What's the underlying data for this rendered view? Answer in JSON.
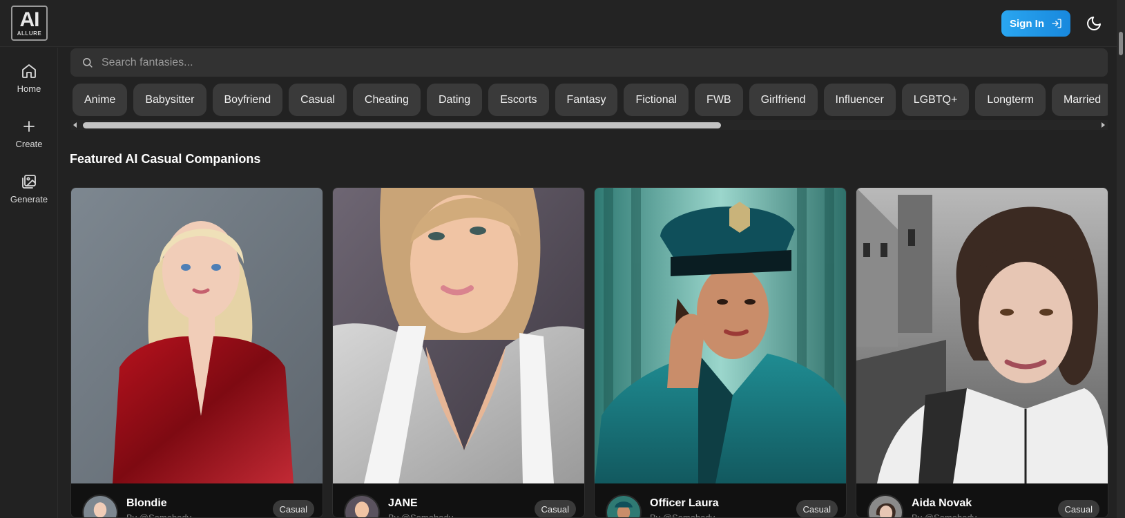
{
  "header": {
    "logo_mark": "AI",
    "logo_word": "ALLURE",
    "sign_in_label": "Sign In",
    "sign_in_icon": "login-arrow-icon",
    "theme_icon": "moon-icon"
  },
  "sidebar": {
    "items": [
      {
        "label": "Home",
        "icon": "home-icon"
      },
      {
        "label": "Create",
        "icon": "plus-icon"
      },
      {
        "label": "Generate",
        "icon": "image-gallery-icon"
      }
    ]
  },
  "search": {
    "placeholder": "Search fantasies...",
    "value": "",
    "icon": "search-icon"
  },
  "categories": [
    "Anime",
    "Babysitter",
    "Boyfriend",
    "Casual",
    "Cheating",
    "Dating",
    "Escorts",
    "Fantasy",
    "Fictional",
    "FWB",
    "Girlfriend",
    "Influencer",
    "LGBTQ+",
    "Longterm",
    "Married"
  ],
  "section": {
    "title": "Featured AI Casual Companions"
  },
  "cards": [
    {
      "name": "Blondie",
      "author": "By @Somebody",
      "tag": "Casual"
    },
    {
      "name": "JANE",
      "author": "By @Somebody",
      "tag": "Casual"
    },
    {
      "name": "Officer Laura",
      "author": "By @Somebody",
      "tag": "Casual"
    },
    {
      "name": "Aida Novak",
      "author": "By @Somebody",
      "tag": "Casual"
    }
  ],
  "colors": {
    "background": "#222222",
    "accent": "#1e96e8",
    "chip": "#3a3a3a"
  }
}
